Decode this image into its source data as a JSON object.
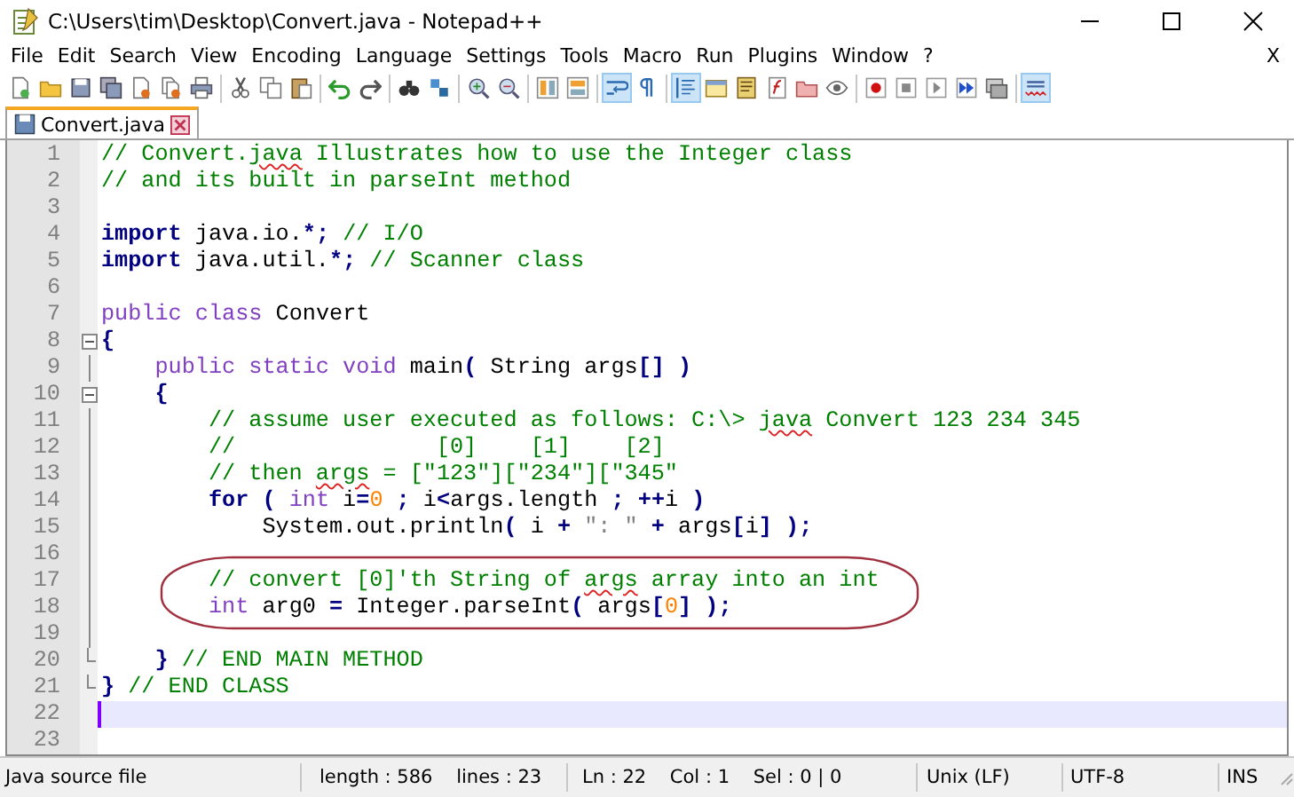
{
  "window": {
    "title": "C:\\Users\\tim\\Desktop\\Convert.java - Notepad++"
  },
  "menu": [
    {
      "label": "File"
    },
    {
      "label": "Edit"
    },
    {
      "label": "Search"
    },
    {
      "label": "View"
    },
    {
      "label": "Encoding"
    },
    {
      "label": "Language"
    },
    {
      "label": "Settings"
    },
    {
      "label": "Tools"
    },
    {
      "label": "Macro"
    },
    {
      "label": "Run"
    },
    {
      "label": "Plugins"
    },
    {
      "label": "Window"
    },
    {
      "label": "?"
    }
  ],
  "menu_close": "X",
  "toolbar": [
    {
      "kind": "button",
      "pressed": false
    },
    {
      "kind": "button",
      "pressed": false
    },
    {
      "kind": "button",
      "pressed": false
    },
    {
      "kind": "button",
      "pressed": false
    },
    {
      "kind": "button",
      "pressed": false
    },
    {
      "kind": "button",
      "pressed": false
    },
    {
      "kind": "button",
      "pressed": false
    },
    {
      "kind": "separator"
    },
    {
      "kind": "button",
      "pressed": false
    },
    {
      "kind": "button",
      "pressed": false
    },
    {
      "kind": "button",
      "pressed": false
    },
    {
      "kind": "separator"
    },
    {
      "kind": "button",
      "pressed": false
    },
    {
      "kind": "button",
      "pressed": false
    },
    {
      "kind": "separator"
    },
    {
      "kind": "button",
      "pressed": false
    },
    {
      "kind": "button",
      "pressed": false
    },
    {
      "kind": "separator"
    },
    {
      "kind": "button",
      "pressed": false
    },
    {
      "kind": "button",
      "pressed": false
    },
    {
      "kind": "separator"
    },
    {
      "kind": "button",
      "pressed": false
    },
    {
      "kind": "button",
      "pressed": false
    },
    {
      "kind": "separator"
    },
    {
      "kind": "button",
      "pressed": true
    },
    {
      "kind": "button",
      "pressed": false
    },
    {
      "kind": "separator"
    },
    {
      "kind": "button",
      "pressed": true
    },
    {
      "kind": "button",
      "pressed": false
    },
    {
      "kind": "button",
      "pressed": false
    },
    {
      "kind": "button",
      "pressed": false
    },
    {
      "kind": "button",
      "pressed": false
    },
    {
      "kind": "button",
      "pressed": false
    },
    {
      "kind": "separator"
    },
    {
      "kind": "button",
      "pressed": false
    },
    {
      "kind": "button",
      "pressed": false
    },
    {
      "kind": "button",
      "pressed": false
    },
    {
      "kind": "button",
      "pressed": false
    },
    {
      "kind": "button",
      "pressed": false
    },
    {
      "kind": "separator"
    },
    {
      "kind": "button",
      "pressed": true
    }
  ],
  "tabs": [
    {
      "label": "Convert.java",
      "selected": true
    }
  ],
  "editor": {
    "lines": [
      {
        "number": "1",
        "tokens": [
          {
            "kind": "comment",
            "text": "// Convert."
          },
          {
            "kind": "comment",
            "text": "java",
            "misspelled": true
          },
          {
            "kind": "comment",
            "text": " Illustrates how to use the Integer class"
          }
        ]
      },
      {
        "number": "2",
        "tokens": [
          {
            "kind": "comment",
            "text": "// and its built in parseInt method"
          }
        ]
      },
      {
        "number": "3"
      },
      {
        "number": "4",
        "tokens": [
          {
            "kind": "keyword",
            "text": "import"
          },
          {
            "kind": "plain",
            "text": " java.io."
          },
          {
            "kind": "operator",
            "text": "*;"
          },
          {
            "kind": "comment",
            "text": " // I/O"
          }
        ]
      },
      {
        "number": "5",
        "tokens": [
          {
            "kind": "keyword",
            "text": "import"
          },
          {
            "kind": "plain",
            "text": " java.util."
          },
          {
            "kind": "operator",
            "text": "*;"
          },
          {
            "kind": "comment",
            "text": " // Scanner class"
          }
        ]
      },
      {
        "number": "6"
      },
      {
        "number": "7",
        "tokens": [
          {
            "kind": "type",
            "text": "public"
          },
          {
            "kind": "type",
            "text": " class"
          },
          {
            "kind": "plain",
            "text": " Convert"
          }
        ]
      },
      {
        "number": "8",
        "fold_toggle": true,
        "tokens": [
          {
            "kind": "operator",
            "text": "{"
          }
        ]
      },
      {
        "number": "9",
        "fold_line": true,
        "tokens": [
          {
            "kind": "type",
            "text": "    public"
          },
          {
            "kind": "type",
            "text": " static"
          },
          {
            "kind": "type",
            "text": " void"
          },
          {
            "kind": "plain",
            "text": " main"
          },
          {
            "kind": "operator",
            "text": "("
          },
          {
            "kind": "plain",
            "text": " String args"
          },
          {
            "kind": "operator",
            "text": "[]"
          },
          {
            "kind": "operator",
            "text": " )"
          }
        ]
      },
      {
        "number": "10",
        "fold_toggle": true,
        "tokens": [
          {
            "kind": "operator",
            "text": "    {"
          }
        ]
      },
      {
        "number": "11",
        "fold_line": true,
        "tokens": [
          {
            "kind": "comment",
            "text": "        // assume user executed as follows: C:\\> "
          },
          {
            "kind": "comment",
            "text": "java",
            "misspelled": true
          },
          {
            "kind": "comment",
            "text": " Convert 123 234 345"
          }
        ]
      },
      {
        "number": "12",
        "fold_line": true,
        "tokens": [
          {
            "kind": "comment",
            "text": "        //               [0]    [1]    [2]"
          }
        ]
      },
      {
        "number": "13",
        "fold_line": true,
        "tokens": [
          {
            "kind": "comment",
            "text": "        // then "
          },
          {
            "kind": "comment",
            "text": "args",
            "misspelled": true
          },
          {
            "kind": "comment",
            "text": " = [\"123\"][\"234\"][\"345\""
          }
        ]
      },
      {
        "number": "14",
        "fold_line": true,
        "tokens": [
          {
            "kind": "keyword",
            "text": "        for"
          },
          {
            "kind": "operator",
            "text": " ("
          },
          {
            "kind": "type",
            "text": " int"
          },
          {
            "kind": "plain",
            "text": " i"
          },
          {
            "kind": "operator",
            "text": "="
          },
          {
            "kind": "number",
            "text": "0"
          },
          {
            "kind": "operator",
            "text": " ;"
          },
          {
            "kind": "plain",
            "text": " i"
          },
          {
            "kind": "operator",
            "text": "<"
          },
          {
            "kind": "plain",
            "text": "args.length"
          },
          {
            "kind": "operator",
            "text": " ;"
          },
          {
            "kind": "operator",
            "text": " ++"
          },
          {
            "kind": "plain",
            "text": "i"
          },
          {
            "kind": "operator",
            "text": " )"
          }
        ]
      },
      {
        "number": "15",
        "fold_line": true,
        "tokens": [
          {
            "kind": "plain",
            "text": "            System.out.println"
          },
          {
            "kind": "operator",
            "text": "("
          },
          {
            "kind": "plain",
            "text": " i"
          },
          {
            "kind": "operator",
            "text": " +"
          },
          {
            "kind": "string",
            "text": " \": \""
          },
          {
            "kind": "operator",
            "text": " +"
          },
          {
            "kind": "plain",
            "text": " args"
          },
          {
            "kind": "operator",
            "text": "["
          },
          {
            "kind": "plain",
            "text": "i"
          },
          {
            "kind": "operator",
            "text": "]"
          },
          {
            "kind": "operator",
            "text": " );"
          }
        ]
      },
      {
        "number": "16",
        "fold_line": true
      },
      {
        "number": "17",
        "fold_line": true,
        "tokens": [
          {
            "kind": "comment",
            "text": "        // convert [0]'th String of "
          },
          {
            "kind": "comment",
            "text": "args",
            "misspelled": true
          },
          {
            "kind": "comment",
            "text": " array into an int"
          }
        ]
      },
      {
        "number": "18",
        "fold_line": true,
        "tokens": [
          {
            "kind": "type",
            "text": "        int"
          },
          {
            "kind": "plain",
            "text": " arg0"
          },
          {
            "kind": "operator",
            "text": " ="
          },
          {
            "kind": "plain",
            "text": " Integer.parseInt"
          },
          {
            "kind": "operator",
            "text": "("
          },
          {
            "kind": "plain",
            "text": " args"
          },
          {
            "kind": "operator",
            "text": "["
          },
          {
            "kind": "number",
            "text": "0"
          },
          {
            "kind": "operator",
            "text": "]"
          },
          {
            "kind": "operator",
            "text": " );"
          }
        ]
      },
      {
        "number": "19",
        "fold_line": true
      },
      {
        "number": "20",
        "fold_end": true,
        "tokens": [
          {
            "kind": "operator",
            "text": "    }"
          },
          {
            "kind": "comment",
            "text": " // END MAIN METHOD"
          }
        ]
      },
      {
        "number": "21",
        "fold_end": true,
        "tokens": [
          {
            "kind": "operator",
            "text": "}"
          },
          {
            "kind": "comment",
            "text": " // END CLASS"
          }
        ]
      },
      {
        "number": "22",
        "current": true
      },
      {
        "number": "23"
      }
    ]
  },
  "status_bar": [
    "Java source file",
    "length : 586    lines : 23",
    "Ln : 22    Col : 1    Sel : 0 | 0",
    "Unix (LF)",
    "UTF-8",
    "INS"
  ]
}
